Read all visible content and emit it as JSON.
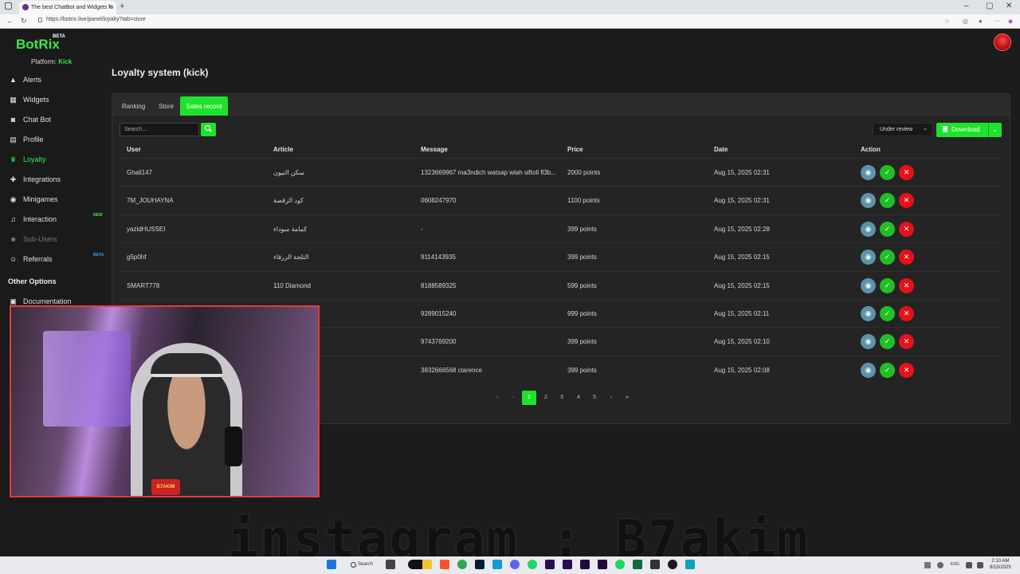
{
  "browser": {
    "tab_title": "The best ChatBot and Widgets fo",
    "url": "https://botrix.live/panel/loyalty?tab=store",
    "new_tab": "+"
  },
  "brand": {
    "name": "BotRix",
    "beta": "BETA",
    "platform_label": "Platform:",
    "platform_name": "Kick",
    "accent": "#1fe22a"
  },
  "sidebar": {
    "items": [
      {
        "label": "Alerts",
        "icon": "warning-icon"
      },
      {
        "label": "Widgets",
        "icon": "grid-icon"
      },
      {
        "label": "Chat Bot",
        "icon": "robot-icon"
      },
      {
        "label": "Profile",
        "icon": "id-card-icon"
      },
      {
        "label": "Loyalty",
        "icon": "trophy-icon",
        "active": true
      },
      {
        "label": "Integrations",
        "icon": "puzzle-icon"
      },
      {
        "label": "Minigames",
        "icon": "gamepad-icon"
      },
      {
        "label": "Interaction",
        "icon": "music-icon",
        "badge": "NEW"
      },
      {
        "label": "Sub-Users",
        "icon": "users-icon",
        "disabled": true
      },
      {
        "label": "Referrals",
        "icon": "user-plus-icon",
        "badge": "BETA"
      }
    ],
    "other_options": "Other Options",
    "documentation": "Documentation"
  },
  "page": {
    "title": "Loyalty system (kick)",
    "tabs": [
      "Ranking",
      "Store",
      "Sales record"
    ],
    "active_tab": "Sales record",
    "search_placeholder": "Search...",
    "status_filter": "Under review",
    "download_label": "Download"
  },
  "table": {
    "columns": [
      "User",
      "Article",
      "Message",
      "Price",
      "Date",
      "Action"
    ],
    "rows": [
      {
        "user": "Ghali147",
        "article": "سكن النيون",
        "message": "1323669967 ma3ndich watsap wlah siftoli fl3b...",
        "price": "2000 points",
        "date": "Aug 15, 2025 02:31"
      },
      {
        "user": "7M_JOUHAYNA",
        "article": "كود الرقصة",
        "message": "0608247970",
        "price": "1100 points",
        "date": "Aug 15, 2025 02:31"
      },
      {
        "user": "yazidHUSSEI",
        "article": "كمامة سوداء",
        "message": "-",
        "price": "399 points",
        "date": "Aug 15, 2025 02:28"
      },
      {
        "user": "g5p0hf",
        "article": "التلجة الزرقاء",
        "message": "9114143935",
        "price": "399 points",
        "date": "Aug 15, 2025 02:15"
      },
      {
        "user": "SMART778",
        "article": "110 Diamond",
        "message": "8188589325",
        "price": "599 points",
        "date": "Aug 15, 2025 02:15"
      },
      {
        "user": "",
        "article": "",
        "message": "9289015240",
        "price": "999 points",
        "date": "Aug 15, 2025 02:11"
      },
      {
        "user": "",
        "article": "",
        "message": "9743769200",
        "price": "399 points",
        "date": "Aug 15, 2025 02:10"
      },
      {
        "user": "",
        "article": "",
        "message": "3832666568 clarence",
        "price": "399 points",
        "date": "Aug 15, 2025 02:08"
      }
    ]
  },
  "pagination": {
    "first": "«",
    "prev": "‹",
    "pages": [
      "1",
      "2",
      "3",
      "4",
      "5"
    ],
    "current": "1",
    "next": "›",
    "last": "»"
  },
  "overlay": {
    "watermark": "instagram : B7akim",
    "cam_logo": "B7AKIM"
  },
  "taskbar": {
    "search": "Search",
    "lang": "ENG",
    "time": "2:10 AM",
    "date": "8/15/2025"
  }
}
